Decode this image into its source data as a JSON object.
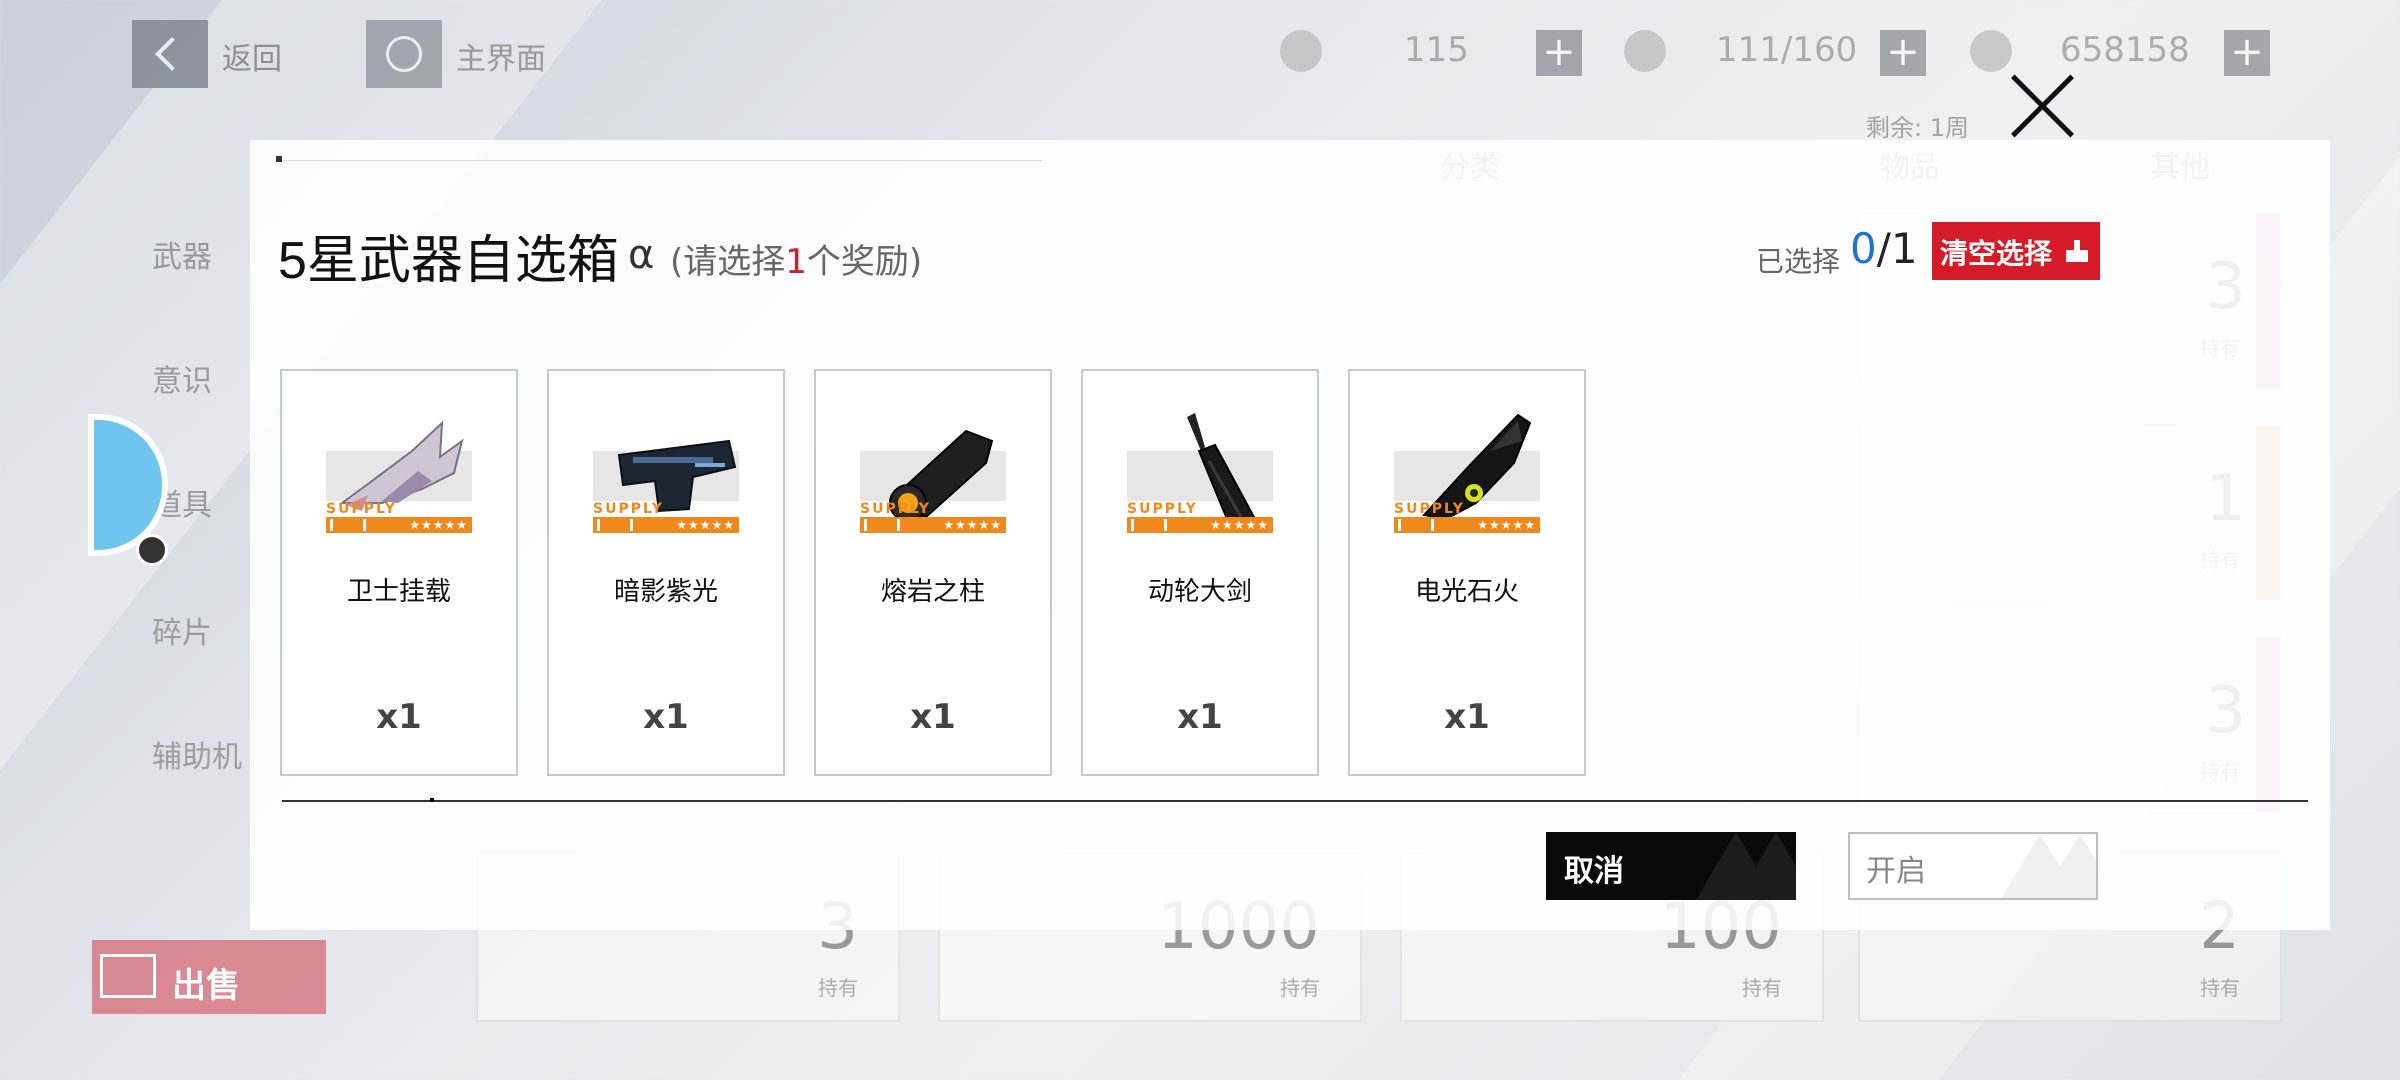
{
  "topbar": {
    "back_label": "返回",
    "home_label": "主界面",
    "resources": [
      {
        "icon": "fuel-icon",
        "value": "115"
      },
      {
        "icon": "stamina-icon",
        "value": "111/160"
      },
      {
        "icon": "coin-icon",
        "value": "658158"
      }
    ],
    "plus": "+"
  },
  "background": {
    "remaining": "剩余: 1周",
    "side_tabs": [
      "武器",
      "意识",
      "道具",
      "碎片",
      "辅助机"
    ],
    "radios": [
      "分类",
      "物品",
      "其他"
    ],
    "right_cards": [
      {
        "count": "3",
        "own": "持有",
        "color": "#d478d0"
      },
      {
        "count": "1",
        "own": "持有",
        "color": "#f0a070"
      },
      {
        "count": "3",
        "own": "持有",
        "color": "#d478d0"
      }
    ],
    "bottom_cards": [
      {
        "count": "3",
        "own": "持有"
      },
      {
        "count": "1000",
        "own": "持有"
      },
      {
        "count": "100",
        "own": "持有"
      },
      {
        "count": "2",
        "own": "持有"
      }
    ],
    "sell_label": "出售"
  },
  "modal": {
    "title": "5星武器自选箱",
    "alpha": "α",
    "hint_prefix": "(请选择",
    "hint_count": "1",
    "hint_suffix": "个奖励)",
    "selected_label": "已选择",
    "selected_current": "0",
    "selected_total": "/1",
    "clear_label": "清空选择",
    "items": [
      {
        "name": "卫士挂载",
        "qty": "x1",
        "icon": "mech-wing-weapon-icon",
        "supply": "SUPPLY",
        "stars": "★★★★★"
      },
      {
        "name": "暗影紫光",
        "qty": "x1",
        "icon": "pistol-weapon-icon",
        "supply": "SUPPLY",
        "stars": "★★★★★"
      },
      {
        "name": "熔岩之柱",
        "qty": "x1",
        "icon": "cannon-weapon-icon",
        "supply": "SUPPLY",
        "stars": "★★★★★"
      },
      {
        "name": "动轮大剑",
        "qty": "x1",
        "icon": "greatsword-weapon-icon",
        "supply": "SUPPLY",
        "stars": "★★★★★"
      },
      {
        "name": "电光石火",
        "qty": "x1",
        "icon": "chainsaw-weapon-icon",
        "supply": "SUPPLY",
        "stars": "★★★★★"
      }
    ],
    "cancel_label": "取消",
    "open_label": "开启"
  },
  "colors": {
    "accent_red": "#d51b28",
    "selected_blue": "#1e74d0",
    "supply_orange": "#f0891c"
  }
}
